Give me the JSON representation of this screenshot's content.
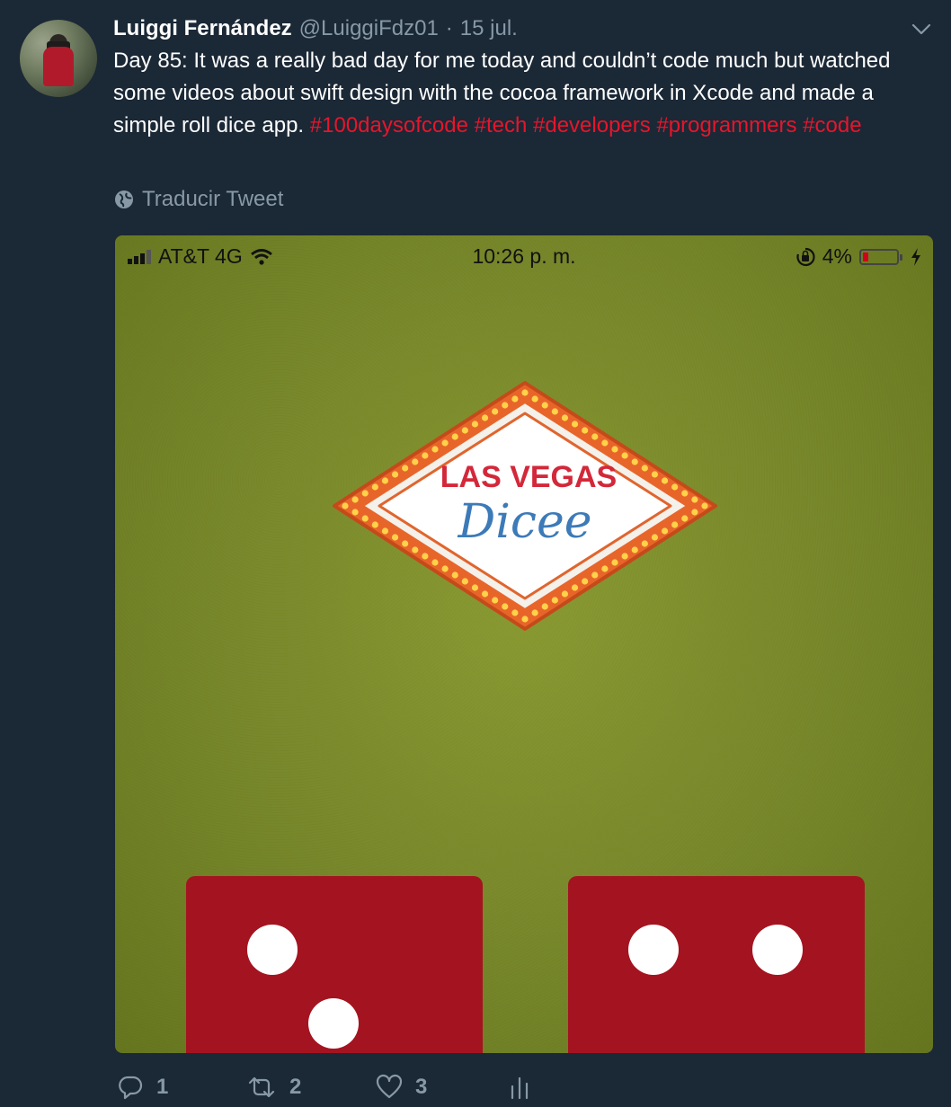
{
  "tweet": {
    "author_name": "Luiggi Fernández",
    "handle": "@LuiggiFdz01",
    "separator": "·",
    "date": "15 jul.",
    "text": "Day 85: It was a really bad day for me today and couldn’t code much but watched some videos about swift design with the cocoa framework in Xcode and made a simple roll dice app.",
    "hashtags": [
      "#100daysofcode",
      "#tech",
      "#developers",
      "#programmers",
      "#code"
    ],
    "translate_label": "Traducir Tweet"
  },
  "media": {
    "status_bar": {
      "carrier": "AT&T 4G",
      "time": "10:26 p. m.",
      "battery_percent_label": "4%",
      "battery_level": 0.04
    },
    "logo_text": {
      "line1": "LAS VEGAS",
      "line2": "Dicee"
    },
    "dice": [
      {
        "value_shown": 2
      },
      {
        "value_shown": 2
      }
    ],
    "colors": {
      "felt": "#7a8a2c",
      "dice": "#a31420",
      "sign_border": "#e8652a",
      "sign_text_red": "#d3283a",
      "sign_text_blue": "#3c7ab8"
    }
  },
  "actions": {
    "reply_count": "1",
    "retweet_count": "2",
    "like_count": "3"
  },
  "colors": {
    "background": "#1b2836",
    "hashtag": "#e8152b",
    "muted": "#8899a6"
  }
}
